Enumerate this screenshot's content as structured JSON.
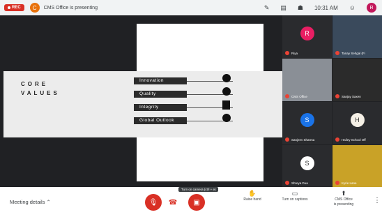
{
  "topbar": {
    "rec_label": "REC",
    "presenter_initial": "C",
    "presenter_text": "CMS Office is presenting",
    "time": "10:31 AM",
    "me_initial": "R",
    "icons": [
      "edit-icon",
      "chat-icon",
      "people-icon",
      "time",
      "profile"
    ]
  },
  "slide": {
    "title_line1": "CORE",
    "title_line2": "VALUES",
    "values": [
      "Innovation",
      "Quality",
      "Integrity",
      "Global Outlook"
    ]
  },
  "participants": [
    {
      "name": "Riya",
      "type": "avatar",
      "initial": "R",
      "color": "#e91e63"
    },
    {
      "name": "Tanay Sehgal (Fi",
      "type": "video",
      "color": "#3a4a5c"
    },
    {
      "name": "CMS Office",
      "type": "video",
      "color": "#8a8f96"
    },
    {
      "name": "Sanjay Saxen",
      "type": "video",
      "color": "#2b2b2b"
    },
    {
      "name": "Sanjeev Sharma",
      "type": "avatar",
      "initial": "S",
      "color": "#1a73e8"
    },
    {
      "name": "Hailey School Off",
      "type": "avatar",
      "initial": "H",
      "color": "#f5f0e6"
    },
    {
      "name": "Shreya Dua",
      "type": "avatar",
      "initial": "S",
      "color": "#fff"
    },
    {
      "name": "Kyrie Lane",
      "type": "video",
      "color": "#c9a227"
    }
  ],
  "bottombar": {
    "meeting_details": "Meeting details",
    "tooltip": "Turn on camera (ctrl + e)",
    "raise_hand": "Raise hand",
    "captions": "Turn on captions",
    "presenting_line1": "CMS Office",
    "presenting_line2": "is presenting"
  }
}
